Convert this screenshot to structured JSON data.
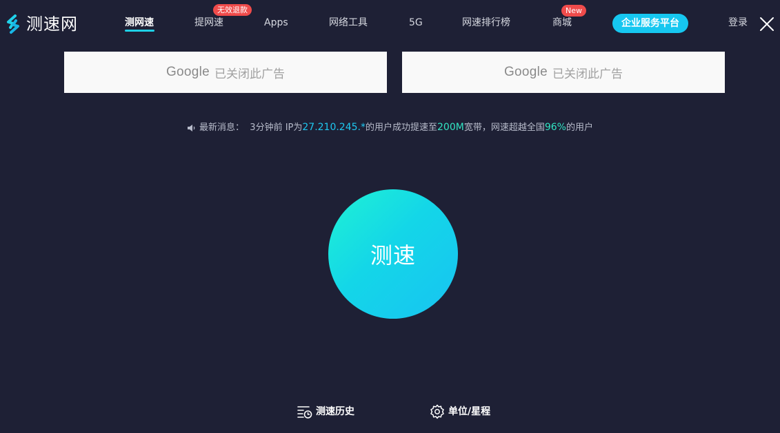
{
  "brand": {
    "name": "测速网"
  },
  "nav": {
    "items": [
      {
        "label": "测网速"
      },
      {
        "label": "提网速",
        "badge": "无效退款"
      },
      {
        "label": "Apps"
      },
      {
        "label": "网络工具"
      },
      {
        "label": "5G"
      },
      {
        "label": "网速排行榜"
      },
      {
        "label": "商城",
        "badge": "New"
      }
    ],
    "enterprise_label": "企业服务平台",
    "login_label": "登录"
  },
  "ads": [
    {
      "brand": "Google",
      "text": "已关闭此广告"
    },
    {
      "brand": "Google",
      "text": "已关闭此广告"
    }
  ],
  "news": {
    "prefix": "最新消息：",
    "time": "3分钟前 IP为",
    "ip": "27.210.245.*",
    "mid": "的用户成功提速至",
    "speed": "200M",
    "mid2": "宽带，网速超越全国",
    "percent": "96%",
    "suffix": "的用户"
  },
  "main": {
    "start_label": "测速"
  },
  "footer": {
    "history_label": "测速历史",
    "units_label": "单位/星程"
  },
  "colors": {
    "background": "#1e2035",
    "accent": "#16c7f0",
    "badge": "#ef4b4b",
    "highlight_green": "#32e6c4"
  },
  "icons": {
    "logo": "swirl-logo-icon",
    "speaker": "speaker-icon",
    "close": "close-icon",
    "history": "history-list-icon",
    "settings": "gear-icon"
  }
}
